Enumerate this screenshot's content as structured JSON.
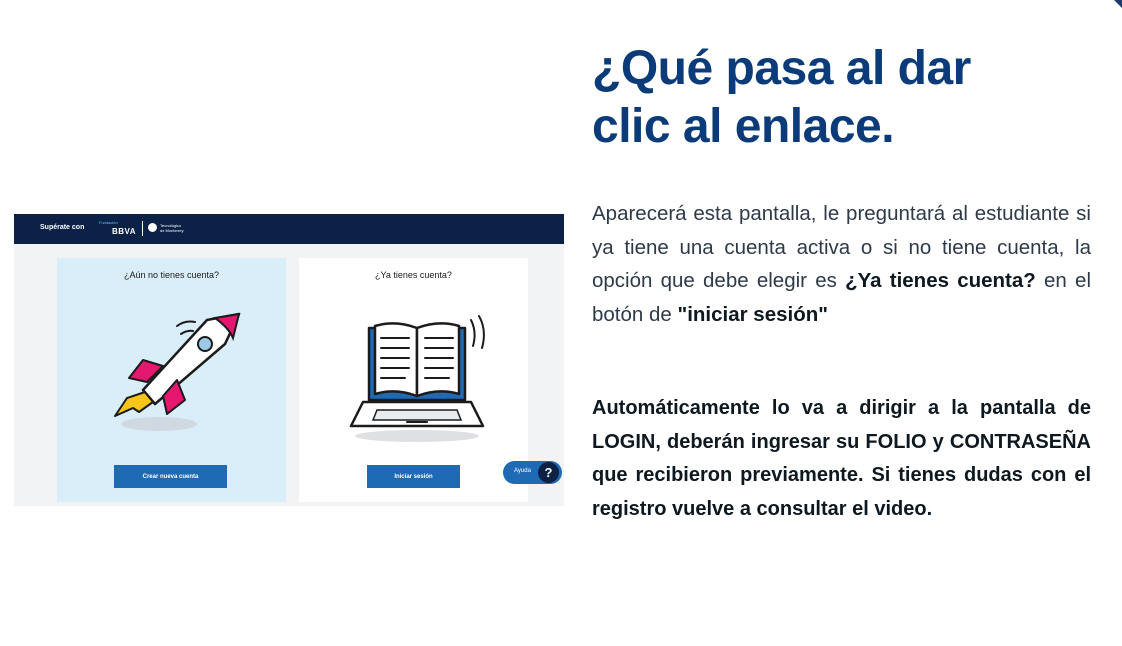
{
  "heading": {
    "line1": "¿Qué pasa al dar",
    "line2": "clic al enlace."
  },
  "paragraph1": {
    "intro": "Aparecerá esta pantalla, le preguntará al estudiante si ya tiene una cuenta activa o si no tiene cuenta, la opción que debe elegir es ",
    "option": "¿Ya tienes cuenta?",
    "middle": " en el botón de ",
    "button_ref": "\"iniciar sesión\""
  },
  "paragraph2": {
    "text": "Automáticamente lo va a dirigir a la pantalla de LOGIN, deberán ingresar su FOLIO y CONTRASEÑA que recibieron previamente. Si tienes dudas con el registro vuelve a consultar el video."
  },
  "screenshot": {
    "brand_text": "Supérate con",
    "fundacion": "Fundación",
    "bbva": "BBVA",
    "tec_line1": "Tecnológico",
    "tec_line2": "de Monterrey",
    "card_new": {
      "title": "¿Aún no tienes cuenta?",
      "button": "Crear nueva cuenta"
    },
    "card_existing": {
      "title": "¿Ya tienes cuenta?",
      "button": "Iniciar sesión"
    },
    "help_label": "Ayuda",
    "help_icon": "?"
  },
  "colors": {
    "heading": "#0b3b78",
    "top_bar": "#0b2145",
    "button": "#1e6ab4",
    "card_left_bg": "#d9eef8",
    "accent_pink": "#e5176f"
  },
  "icons": [
    "rocket-illustration",
    "laptop-book-illustration",
    "tec-logo-icon",
    "help-icon"
  ]
}
